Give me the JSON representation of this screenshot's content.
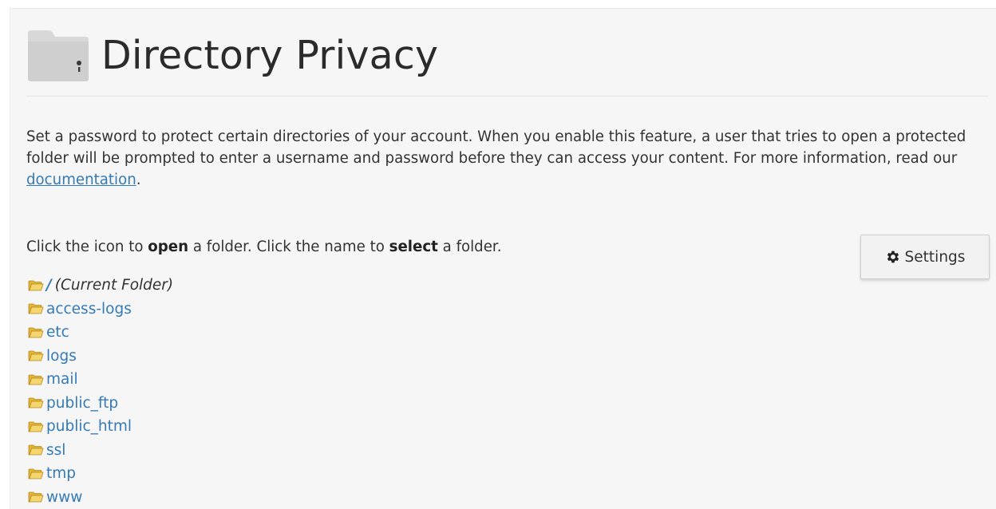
{
  "header": {
    "title": "Directory Privacy",
    "icon": "folder-lock-icon"
  },
  "intro": {
    "text_before_link": "Set a password to protect certain directories of your account. When you enable this feature, a user that tries to open a protected folder will be prompted to enter a username and password before they can access your content. For more information, read our ",
    "link_text": "documentation",
    "text_after_link": "."
  },
  "instructions": {
    "part1": "Click the icon to ",
    "bold1": "open",
    "part2": " a folder. Click the name to ",
    "bold2": "select",
    "part3": " a folder."
  },
  "settings_button": {
    "label": "Settings",
    "icon": "gear-icon"
  },
  "folders": {
    "current": {
      "slash": "/",
      "label": "(Current Folder)"
    },
    "items": [
      "access-logs",
      "etc",
      "logs",
      "mail",
      "public_ftp",
      "public_html",
      "ssl",
      "tmp",
      "www"
    ]
  },
  "colors": {
    "link": "#337ab7",
    "folder_icon": "#f0c94a"
  }
}
